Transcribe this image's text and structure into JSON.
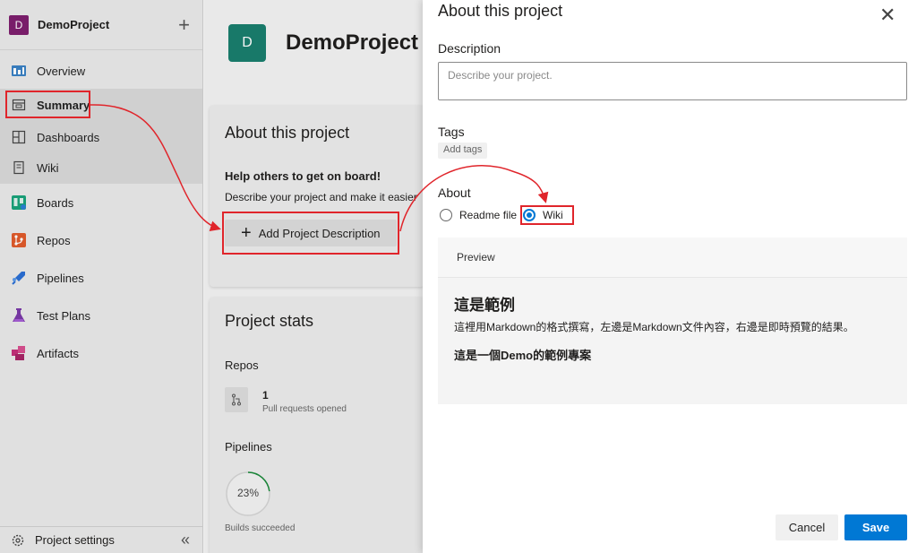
{
  "sidebar": {
    "project_initial": "D",
    "project_name": "DemoProject",
    "items": [
      {
        "label": "Overview"
      },
      {
        "label": "Summary"
      },
      {
        "label": "Dashboards"
      },
      {
        "label": "Wiki"
      },
      {
        "label": "Boards"
      },
      {
        "label": "Repos"
      },
      {
        "label": "Pipelines"
      },
      {
        "label": "Test Plans"
      },
      {
        "label": "Artifacts"
      }
    ],
    "footer_label": "Project settings"
  },
  "main": {
    "project_initial": "D",
    "project_title": "DemoProject",
    "about_card": {
      "title": "About this project",
      "subtitle": "Help others to get on board!",
      "text": "Describe your project and make it easier",
      "button_label": "Add Project Description"
    },
    "stats_card": {
      "title": "Project stats",
      "repos_label": "Repos",
      "pr_count": "1",
      "pr_caption": "Pull requests opened",
      "pipelines_label": "Pipelines",
      "builds_percent": "23%",
      "builds_fraction": 0.23,
      "builds_caption": "Builds succeeded"
    }
  },
  "panel": {
    "title": "About this project",
    "description_label": "Description",
    "description_placeholder": "Describe your project.",
    "tags_label": "Tags",
    "tags_placeholder": "Add tags",
    "about_label": "About",
    "radio_readme": "Readme file",
    "radio_wiki": "Wiki",
    "selected": "Wiki",
    "preview_label": "Preview",
    "preview_heading": "這是範例",
    "preview_paragraph": "這裡用Markdown的格式撰寫，左邊是Markdown文件內容，右邊是即時預覽的結果。",
    "preview_subheading": "這是一個Demo的範例專案",
    "cancel_label": "Cancel",
    "save_label": "Save"
  },
  "colors": {
    "accent": "#0078d4",
    "annotation_red": "#e0252b",
    "project_avatar": "#7d1f6e",
    "main_avatar": "#1a7e6e"
  }
}
